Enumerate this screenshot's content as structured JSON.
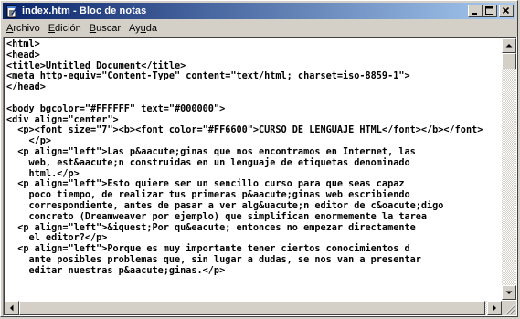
{
  "window": {
    "title": "index.htm - Bloc de notas"
  },
  "menubar": {
    "items": [
      {
        "underline": "A",
        "rest": "rchivo"
      },
      {
        "underline": "E",
        "rest": "dición"
      },
      {
        "underline": "B",
        "rest": "uscar"
      },
      {
        "pre": "Ay",
        "underline": "u",
        "rest": "da"
      }
    ]
  },
  "editor": {
    "content": "<html>\n<head>\n<title>Untitled Document</title>\n<meta http-equiv=\"Content-Type\" content=\"text/html; charset=iso-8859-1\">\n</head>\n\n<body bgcolor=\"#FFFFFF\" text=\"#000000\">\n<div align=\"center\">\n  <p><font size=\"7\"><b><font color=\"#FF6600\">CURSO DE LENGUAJE HTML</font></b></font>\n    </p>\n  <p align=\"left\">Las p&aacute;ginas que nos encontramos en Internet, las\n    web, est&aacute;n construidas en un lenguaje de etiquetas denominado\n    html.</p>\n  <p align=\"left\">Esto quiere ser un sencillo curso para que seas capaz\n    poco tiempo, de realizar tus primeras p&aacute;ginas web escribiendo\n    correspondiente, antes de pasar a ver alg&uacute;n editor de c&oacute;digo\n    concreto (Dreamweaver por ejemplo) que simplifican enormemente la tarea\n  <p align=\"left\">&iquest;Por qu&eacute; entonces no empezar directamente\n    el editor?</p>\n  <p align=\"left\">Porque es muy importante tener ciertos conocimientos d\n    ante posibles problemas que, sin lugar a dudas, se nos van a presentar\n    editar nuestras p&aacute;ginas.</p>"
  },
  "colors": {
    "titlebar_start": "#0a246a",
    "titlebar_end": "#a6caf0",
    "face": "#d4d0c8"
  },
  "icons": {
    "app": "notepad-icon",
    "minimize": "minimize-icon",
    "maximize": "maximize-icon",
    "close": "close-icon"
  }
}
